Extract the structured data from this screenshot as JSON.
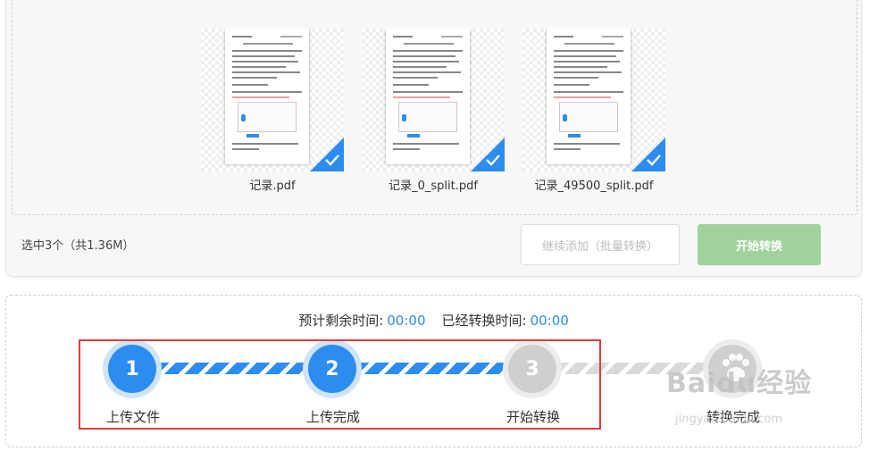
{
  "files": [
    {
      "name": "记录.pdf",
      "selected": true
    },
    {
      "name": "记录_0_split.pdf",
      "selected": true
    },
    {
      "name": "记录_49500_split.pdf",
      "selected": true
    }
  ],
  "selected_info": "选中3个（共1.36M）",
  "buttons": {
    "continue_label": "继续添加（批量转换）",
    "start_label": "开始转换"
  },
  "time": {
    "remaining_label": "预计剩余时间:",
    "remaining_value": "00:00",
    "elapsed_label": "已经转换时间:",
    "elapsed_value": "00:00"
  },
  "steps": [
    {
      "number": "1",
      "label": "上传文件",
      "status": "done"
    },
    {
      "number": "2",
      "label": "上传完成",
      "status": "done"
    },
    {
      "number": "3",
      "label": "开始转换",
      "status": "pending"
    },
    {
      "number": "",
      "label": "转换完成",
      "status": "pending"
    }
  ],
  "watermark": {
    "text": "Baidu经验",
    "sub": "jingyan.baidu.com"
  },
  "colors": {
    "accent": "#2d8cf0",
    "start_button": "#9fd39b",
    "highlight": "#e03b3b"
  }
}
